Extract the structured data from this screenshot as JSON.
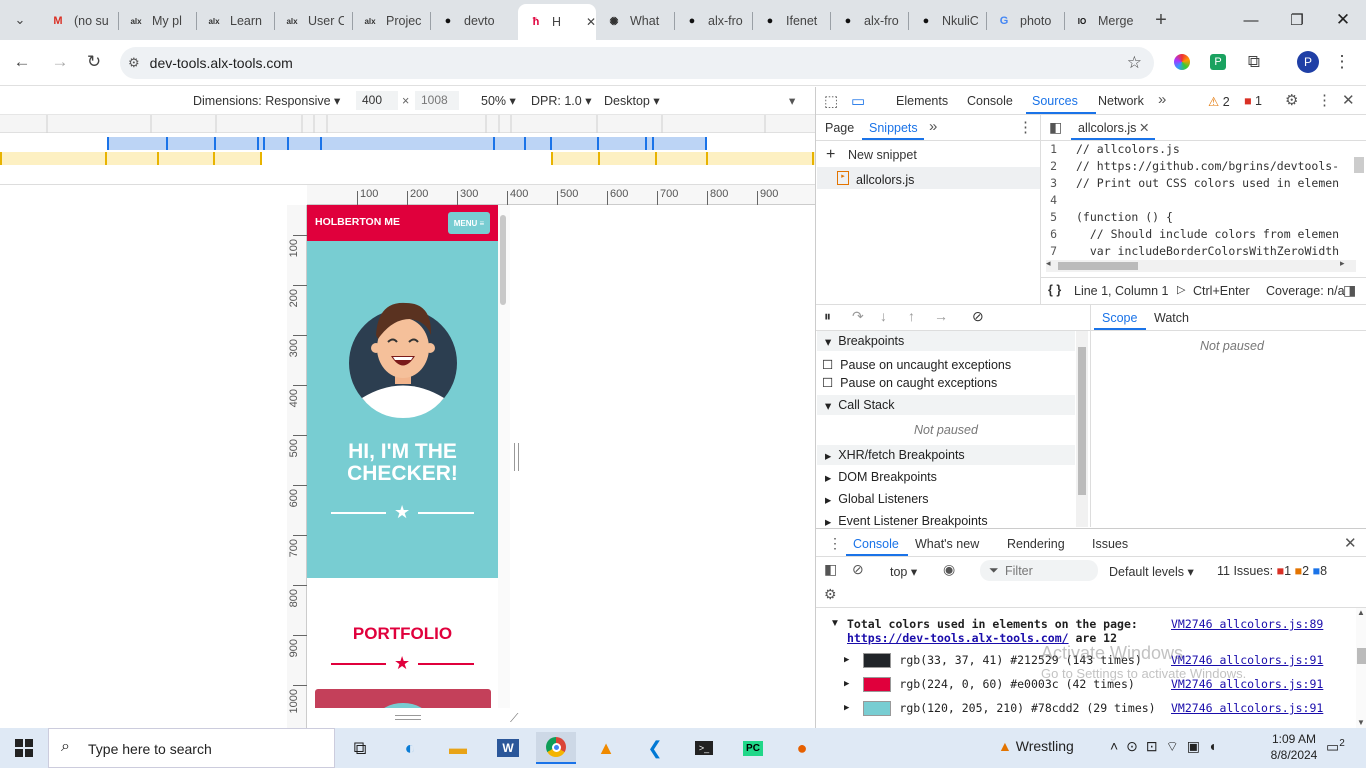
{
  "tabs": [
    {
      "title": "(no su",
      "icon": "gmail-icon",
      "glyph": "M",
      "color": "#d93025"
    },
    {
      "title": "My pl",
      "icon": "alx-icon",
      "glyph": "alx",
      "color": "#333"
    },
    {
      "title": "Learn",
      "icon": "alx-icon",
      "glyph": "alx",
      "color": "#333"
    },
    {
      "title": "User C",
      "icon": "alx-icon",
      "glyph": "alx",
      "color": "#333"
    },
    {
      "title": "Projec",
      "icon": "alx-icon",
      "glyph": "alx",
      "color": "#333"
    },
    {
      "title": "devto",
      "icon": "github-icon",
      "glyph": "●",
      "color": "#111"
    },
    {
      "title": "H",
      "icon": "holberton-icon",
      "glyph": "ħ",
      "color": "#e0003c"
    },
    {
      "title": "What",
      "icon": "openai-icon",
      "glyph": "✺",
      "color": "#333"
    },
    {
      "title": "alx-fro",
      "icon": "github-icon",
      "glyph": "●",
      "color": "#111"
    },
    {
      "title": "Ifenet",
      "icon": "github-icon",
      "glyph": "●",
      "color": "#111"
    },
    {
      "title": "alx-fro",
      "icon": "github-icon",
      "glyph": "●",
      "color": "#111"
    },
    {
      "title": "NkuliC",
      "icon": "github-icon",
      "glyph": "●",
      "color": "#111"
    },
    {
      "title": "photo",
      "icon": "google-icon",
      "glyph": "G",
      "color": "#4285f4"
    },
    {
      "title": "Merge",
      "icon": "merge-icon",
      "glyph": "IO",
      "color": "#111"
    }
  ],
  "toolbar": {
    "url": "dev-tools.alx-tools.com",
    "profile": "P"
  },
  "device": {
    "dimensions": "Dimensions: Responsive",
    "width": "400",
    "times": "×",
    "height": "1008",
    "zoom": "50%",
    "dpr": "DPR: 1.0",
    "mode": "Desktop"
  },
  "ruler": {
    "top": [
      "100",
      "200",
      "300",
      "400",
      "500",
      "600",
      "700",
      "800",
      "900"
    ],
    "left": [
      "100",
      "200",
      "300",
      "400",
      "500",
      "600",
      "700",
      "800",
      "900",
      "1000"
    ]
  },
  "site": {
    "brand": "HOLBERTON ME",
    "menu": "MENU ≡",
    "hero_title": "HI, I'M THE CHECKER!",
    "portfolio": "PORTFOLIO",
    "colors": {
      "teal": "#78cdd2",
      "red": "#e0003c",
      "dark": "#212529"
    }
  },
  "devtools": {
    "tabs": [
      "Elements",
      "Console",
      "Sources",
      "Network"
    ],
    "warnings": "2",
    "errors": "1",
    "nav_tabs": [
      "Page",
      "Snippets"
    ],
    "new_snippet": "New snippet",
    "snippet_file": "allcolors.js",
    "editor_tab": "allcolors.js",
    "code_lines": [
      {
        "n": "1",
        "text": "// allcolors.js"
      },
      {
        "n": "2",
        "text": "// https://github.com/bgrins/devtools-"
      },
      {
        "n": "3",
        "text": "// Print out CSS colors used in elemen"
      },
      {
        "n": "4",
        "text": ""
      },
      {
        "n": "5",
        "text": "(function () {"
      },
      {
        "n": "6",
        "text": "  // Should include colors from elemen"
      },
      {
        "n": "7",
        "text": "  var includeBorderColorsWithZeroWidth"
      }
    ],
    "status_pos": "Line 1, Column 1",
    "run_hint": "Ctrl+Enter",
    "coverage": "Coverage: n/a",
    "breakpoints": "Breakpoints",
    "pause_uncaught": "Pause on uncaught exceptions",
    "pause_caught": "Pause on caught exceptions",
    "call_stack": "Call Stack",
    "not_paused": "Not paused",
    "xhr": "XHR/fetch Breakpoints",
    "dom": "DOM Breakpoints",
    "global": "Global Listeners",
    "event": "Event Listener Breakpoints",
    "scope": "Scope",
    "watch": "Watch",
    "scope_not_paused": "Not paused"
  },
  "drawer": {
    "tabs": [
      "Console",
      "What's new",
      "Rendering",
      "Issues"
    ],
    "context": "top",
    "filter": "Filter",
    "levels": "Default levels",
    "issues_label": "11 Issues:",
    "issues_errors": "1",
    "issues_warnings": "2",
    "issues_info": "8",
    "summary_line1": "Total colors used in elements on the page:",
    "summary_url": "https://dev-tools.alx-tools.com/",
    "summary_tail": " are 12",
    "summary_src": "VM2746 allcolors.js:89",
    "rows": [
      {
        "text": "rgb(33, 37, 41) #212529 (143 times)",
        "color": "#212529",
        "src": "VM2746 allcolors.js:91"
      },
      {
        "text": "rgb(224, 0, 60) #e0003c (42 times)",
        "color": "#e0003c",
        "src": "VM2746 allcolors.js:91"
      },
      {
        "text": "rgb(120, 205, 210) #78cdd2 (29 times)",
        "color": "#78cdd2",
        "src": "VM2746 allcolors.js:91"
      }
    ],
    "watermark_1": "Activate Windows",
    "watermark_2": "Go to Settings to activate Windows."
  },
  "taskbar": {
    "search": "Type here to search",
    "weather": "Wrestling",
    "time": "1:09 AM",
    "date": "8/8/2024",
    "notifications": "2"
  }
}
